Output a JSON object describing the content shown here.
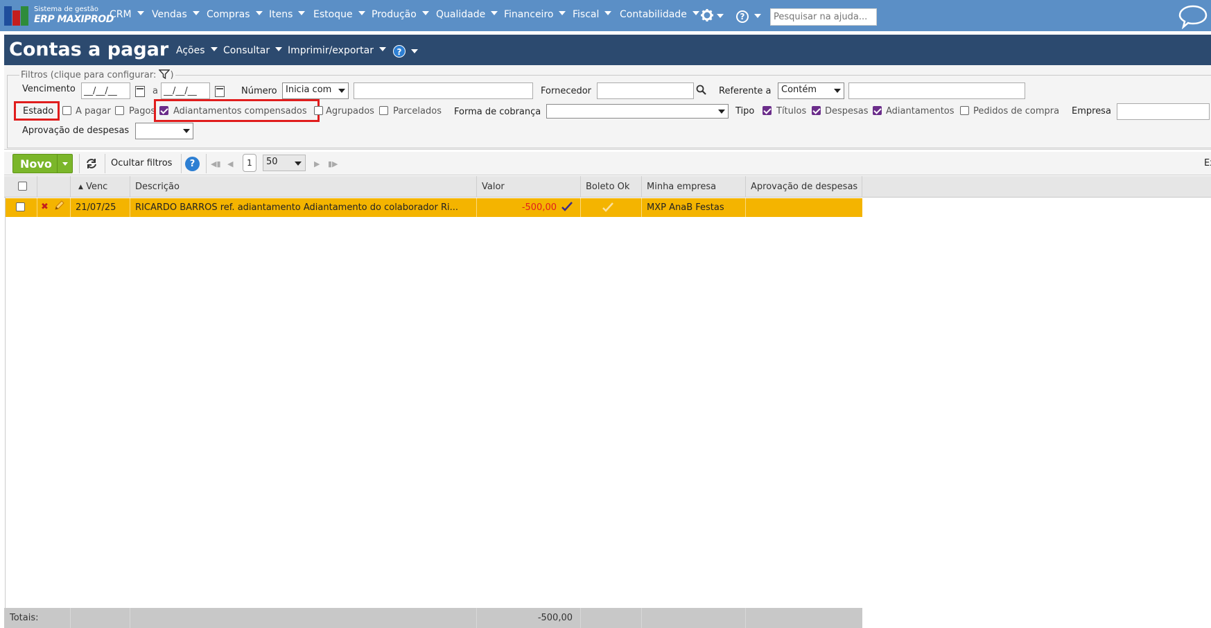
{
  "brand": {
    "line1": "Sistema de gestão",
    "line2": "ERP MAXIPROD",
    "colors": [
      "#1e4e9c",
      "#c41e1e",
      "#2e8b3a"
    ]
  },
  "nav": {
    "items": [
      {
        "label": "CRM"
      },
      {
        "label": "Vendas"
      },
      {
        "label": "Compras"
      },
      {
        "label": "Itens"
      },
      {
        "label": "Estoque"
      },
      {
        "label": "Produção"
      },
      {
        "label": "Qualidade"
      },
      {
        "label": "Financeiro"
      },
      {
        "label": "Fiscal"
      },
      {
        "label": "Contabilidade"
      }
    ],
    "settings_icon": "gear-icon",
    "help_icon": "help-icon",
    "search_placeholder": "Pesquisar na ajuda...",
    "chat_icon": "chat-bubble-icon",
    "bar_color": "#5b8fc6"
  },
  "titlebar": {
    "title": "Contas a pagar",
    "menus": [
      {
        "label": "Ações"
      },
      {
        "label": "Consultar"
      },
      {
        "label": "Imprimir/exportar"
      }
    ],
    "help_glyph": "?",
    "bar_color": "#2c4a6f"
  },
  "filters": {
    "legend": "Filtros (clique para configurar:",
    "legend_close": ")",
    "vencimento": {
      "label": "Vencimento",
      "from": "__/__/__",
      "sep": "a",
      "to": "__/__/__"
    },
    "numero": {
      "label": "Número",
      "mode": "Inicia com",
      "value": ""
    },
    "fornecedor": {
      "label": "Fornecedor",
      "value": ""
    },
    "referente": {
      "label": "Referente a",
      "mode": "Contém",
      "value": ""
    },
    "estado": {
      "label": "Estado",
      "options": [
        {
          "label": "A pagar",
          "checked": false
        },
        {
          "label": "Pagos",
          "checked": false
        },
        {
          "label": "Adiantamentos compensados",
          "checked": true
        },
        {
          "label": "Agrupados",
          "checked": false
        },
        {
          "label": "Parcelados",
          "checked": false
        }
      ]
    },
    "forma_cobranca": {
      "label": "Forma de cobrança",
      "value": ""
    },
    "tipo": {
      "label": "Tipo",
      "options": [
        {
          "label": "Títulos",
          "checked": true
        },
        {
          "label": "Despesas",
          "checked": true
        },
        {
          "label": "Adiantamentos",
          "checked": true
        },
        {
          "label": "Pedidos de compra",
          "checked": false
        }
      ]
    },
    "empresa": {
      "label": "Empresa",
      "value": ""
    },
    "aprovacao": {
      "label": "Aprovação de despesas",
      "value": ""
    },
    "highlight_color": "#e01d1d",
    "checkbox_color": "#6b2d8a"
  },
  "toolbar": {
    "new_label": "Novo",
    "hide_filters_label": "Ocultar filtros",
    "page": "1",
    "page_size": "50",
    "export_label": "Ex",
    "new_color": "#7bb62a"
  },
  "grid": {
    "columns": {
      "venc": "Venc",
      "descricao": "Descrição",
      "valor": "Valor",
      "boleto": "Boleto Ok",
      "empresa": "Minha empresa",
      "aprovacao": "Aprovação de despesas"
    },
    "rows": [
      {
        "venc": "21/07/25",
        "descricao": "RICARDO BARROS ref. adiantamento Adiantamento do colaborador Ri...",
        "valor": "-500,00",
        "empresa": "MXP AnaB Festas",
        "aprovacao": ""
      }
    ],
    "row_color": "#f4b400",
    "negative_color": "#e01d1d"
  },
  "footer": {
    "label": "Totais:",
    "total": "-500,00"
  }
}
